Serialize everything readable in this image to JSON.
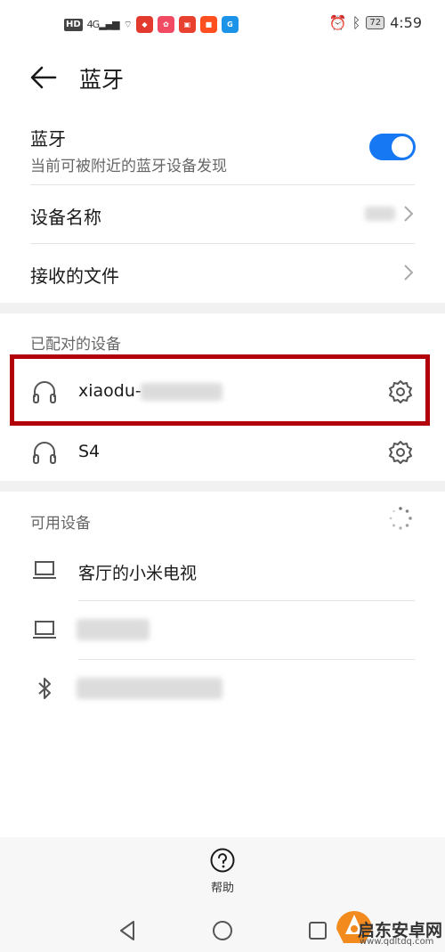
{
  "status_bar": {
    "network_label": "HD",
    "network_type": "4G",
    "time": "4:59",
    "battery": "72",
    "icons": [
      "alarm-icon",
      "bluetooth-icon"
    ]
  },
  "header": {
    "title": "蓝牙",
    "back_icon": "arrow-left-icon"
  },
  "bluetooth": {
    "label": "蓝牙",
    "subtitle": "当前可被附近的蓝牙设备发现",
    "enabled": true
  },
  "settings": [
    {
      "label": "设备名称"
    },
    {
      "label": "接收的文件"
    }
  ],
  "paired_section": {
    "title": "已配对的设备",
    "devices": [
      {
        "name": "xiaodu-",
        "icon": "headphones-icon",
        "settings_icon": "gear-icon",
        "highlighted": true
      },
      {
        "name": "S4",
        "icon": "headphones-icon",
        "settings_icon": "gear-icon",
        "highlighted": false
      }
    ]
  },
  "available_section": {
    "title": "可用设备",
    "devices": [
      {
        "name": "客厅的小米电视",
        "icon": "laptop-icon"
      },
      {
        "name": "",
        "icon": "laptop-icon"
      },
      {
        "name": "",
        "icon": "bluetooth-icon"
      }
    ]
  },
  "help": {
    "label": "帮助",
    "icon": "question-icon"
  },
  "watermark": {
    "line1": "启东安卓网",
    "line2": "www.qdltdq.com"
  },
  "colors": {
    "accent": "#1678f2",
    "highlight_border": "#b2000b",
    "band": "#f1f1f1"
  }
}
